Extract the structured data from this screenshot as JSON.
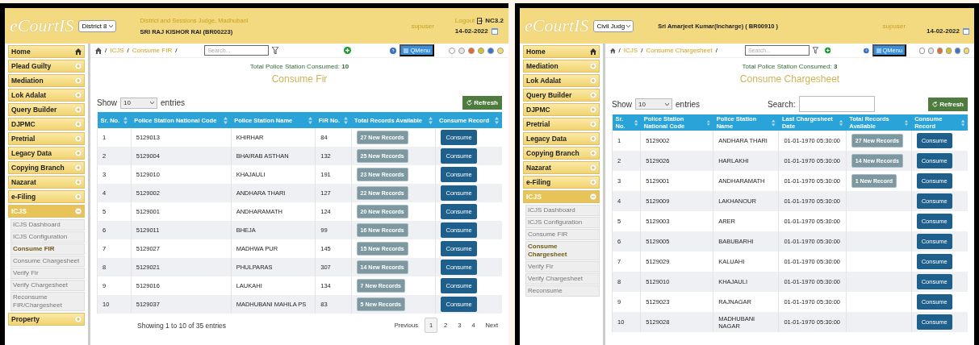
{
  "panels": [
    {
      "header": {
        "logo": "eCourtIS",
        "court_select": "District 8",
        "court_name": "District and Sessions Judge, Madhubani",
        "judge": "SRI RAJ KISHOR RAI (BR00223)",
        "user": "supuser",
        "logout": "Logout",
        "version": "NC3.2",
        "date": "14-02-2022"
      },
      "sidebar": {
        "home": "Home",
        "items": [
          {
            "label": "Plead Guilty",
            "expanded": false
          },
          {
            "label": "Mediation",
            "expanded": false
          },
          {
            "label": "Lok Adalat",
            "expanded": false
          },
          {
            "label": "Query Builder",
            "expanded": false
          },
          {
            "label": "DJPMC",
            "expanded": false
          },
          {
            "label": "Pretrial",
            "expanded": false
          },
          {
            "label": "Legacy Data",
            "expanded": false
          },
          {
            "label": "Copying Branch",
            "expanded": false
          },
          {
            "label": "Nazarat",
            "expanded": false
          },
          {
            "label": "e-Filing",
            "expanded": false
          },
          {
            "label": "ICJS",
            "expanded": true,
            "children": [
              {
                "label": "ICJS Dashboard",
                "selected": false
              },
              {
                "label": "ICJS Configuration",
                "selected": false
              },
              {
                "label": "Consume FIR",
                "selected": true
              },
              {
                "label": "Consume Chargesheet",
                "selected": false
              },
              {
                "label": "Verify Fir",
                "selected": false
              },
              {
                "label": "Verify Chargesheet",
                "selected": false
              },
              {
                "label": "Reconsume FIR/Chargesheet",
                "selected": false
              }
            ]
          },
          {
            "label": "Property",
            "expanded": false
          }
        ]
      },
      "breadcrumb": [
        "ICJS",
        "Consume FIR"
      ],
      "breadcrumb_separator": "/",
      "search": {
        "placeholder": "Search..."
      },
      "qmenu": "QMenu",
      "themes": [
        {
          "color": "#ffffff"
        },
        {
          "color": "#e6e6e6"
        },
        {
          "color": "#e8692c"
        },
        {
          "color": "#d6c31c"
        },
        {
          "color": "#3b73c4"
        },
        {
          "color": "#f3dc6a"
        }
      ],
      "summary_label": "Total Police Station Consumed:",
      "summary_count": "10",
      "title": "Consume Fir",
      "show": "Show",
      "page_size": "10",
      "entries": "entries",
      "refresh": "Refresh",
      "columns": [
        "Sr. No.",
        "Police Station National Code",
        "Police Station Name",
        "FIR No.",
        "Total Records Available",
        "Consume Record"
      ],
      "rows": [
        {
          "cells": [
            "1",
            "5129013",
            "KHIRHAR",
            "84"
          ],
          "records": "27 New Records",
          "action": "Consume"
        },
        {
          "cells": [
            "2",
            "5129004",
            "BHAIRAB ASTHAN",
            "132"
          ],
          "records": "25 New Records",
          "action": "Consume"
        },
        {
          "cells": [
            "3",
            "5129010",
            "KHAJAULI",
            "191"
          ],
          "records": "23 New Records",
          "action": "Consume"
        },
        {
          "cells": [
            "4",
            "5129002",
            "ANDHARA THARI",
            "127"
          ],
          "records": "22 New Records",
          "action": "Consume"
        },
        {
          "cells": [
            "5",
            "5129001",
            "ANDHARAMATH",
            "124"
          ],
          "records": "20 New Records",
          "action": "Consume"
        },
        {
          "cells": [
            "6",
            "5129011",
            "BHEJA",
            "99"
          ],
          "records": "16 New Records",
          "action": "Consume"
        },
        {
          "cells": [
            "7",
            "5129027",
            "MADHWA PUR",
            "145"
          ],
          "records": "15 New Records",
          "action": "Consume"
        },
        {
          "cells": [
            "8",
            "5129021",
            "PHULPARAS",
            "307"
          ],
          "records": "14 New Records",
          "action": "Consume"
        },
        {
          "cells": [
            "9",
            "5129016",
            "LAUKAHI",
            "134"
          ],
          "records": "7 New Records",
          "action": "Consume"
        },
        {
          "cells": [
            "10",
            "5129037",
            "MADHUBANI MAHILA PS",
            "83"
          ],
          "records": "5 New Records",
          "action": "Consume"
        }
      ],
      "footer": {
        "info": "Showing 1 to 10 of 35 entries",
        "pages": [
          {
            "label": "Previous",
            "selected": false
          },
          {
            "label": "1",
            "selected": true
          },
          {
            "label": "2",
            "selected": false
          },
          {
            "label": "3",
            "selected": false
          },
          {
            "label": "4",
            "selected": false
          },
          {
            "label": "Next",
            "selected": false
          }
        ]
      }
    },
    {
      "header": {
        "logo": "eCourtIS",
        "court_select": "Civil Judg",
        "judge": "Sri Amarjeet Kumar(Incharge) ( BR00910 )",
        "user": "supuser",
        "date": "14-02-2022"
      },
      "sidebar": {
        "home": "Home",
        "items": [
          {
            "label": "Mediation",
            "expanded": false
          },
          {
            "label": "Lok Adalat",
            "expanded": false
          },
          {
            "label": "Query Builder",
            "expanded": false
          },
          {
            "label": "DJPMC",
            "expanded": false
          },
          {
            "label": "Pretrial",
            "expanded": false
          },
          {
            "label": "Legacy Data",
            "expanded": false
          },
          {
            "label": "Copying Branch",
            "expanded": false
          },
          {
            "label": "Nazarat",
            "expanded": false
          },
          {
            "label": "e-Filing",
            "expanded": false
          },
          {
            "label": "ICJS",
            "expanded": true,
            "children": [
              {
                "label": "ICJS Dashboard",
                "selected": false
              },
              {
                "label": "ICJS Configuration",
                "selected": false
              },
              {
                "label": "Consume FIR",
                "selected": false
              },
              {
                "label": "Consume Chargesheet",
                "selected": true
              },
              {
                "label": "Verify Fir",
                "selected": false
              },
              {
                "label": "Verify Chargesheet",
                "selected": false
              },
              {
                "label": "Reconsume",
                "selected": false
              }
            ]
          }
        ]
      },
      "breadcrumb": [
        "ICJS",
        "Consume Chargesheet"
      ],
      "breadcrumb_separator": "/",
      "search": {
        "placeholder": "Search..."
      },
      "qmenu": "QMenu",
      "themes": [
        {
          "color": "#ffffff"
        },
        {
          "color": "#e6e6e6"
        },
        {
          "color": "#e8692c"
        },
        {
          "color": "#d6c31c"
        },
        {
          "color": "#3b73c4"
        },
        {
          "color": "#f3dc6a"
        }
      ],
      "summary_label": "Total Police Station Consumed:",
      "summary_count": "3",
      "title": "Consume Chargesheet",
      "show": "Show",
      "page_size": "10",
      "entries": "entries",
      "table_search_label": "Search:",
      "refresh": "Refresh",
      "columns": [
        "Sr. No.",
        "Police Station National Code",
        "Police Station Name",
        "Last Chargesheet Date",
        "Total Records Available",
        "Consume Record"
      ],
      "rows": [
        {
          "cells": [
            "1",
            "5129002",
            "ANDHARA THARI",
            "01-01-1970 05:30:00"
          ],
          "records": "27 New Records",
          "action": "Consume"
        },
        {
          "cells": [
            "2",
            "5129026",
            "HARLAKHI",
            "01-01-1970 05:30:00"
          ],
          "records": "14 New Records",
          "action": "Consume"
        },
        {
          "cells": [
            "3",
            "5129001",
            "ANDHARAMATH",
            "01-01-1970 05:30:00"
          ],
          "records": "1 New Record",
          "action": "Consume"
        },
        {
          "cells": [
            "4",
            "5129009",
            "LAKHANOUR",
            "01-01-1970 05:30:00"
          ],
          "action": "Consume"
        },
        {
          "cells": [
            "5",
            "5129003",
            "ARER",
            "01-01-1970 05:30:00"
          ],
          "action": "Consume"
        },
        {
          "cells": [
            "6",
            "5129005",
            "BABUBARHI",
            "01-01-1970 05:30:00"
          ],
          "action": "Consume"
        },
        {
          "cells": [
            "7",
            "5129029",
            "KALUAHI",
            "01-01-1970 05:30:00"
          ],
          "action": "Consume"
        },
        {
          "cells": [
            "8",
            "5129010",
            "KHAJAULI",
            "01-01-1970 05:30:00"
          ],
          "action": "Consume"
        },
        {
          "cells": [
            "9",
            "5129023",
            "RAJNAGAR",
            "01-01-1970 05:30:00"
          ],
          "action": "Consume"
        },
        {
          "cells": [
            "10",
            "5129028",
            "MADHUBANI NAGAR",
            "01-01-1970 05:30:00"
          ],
          "action": "Consume"
        }
      ]
    }
  ]
}
